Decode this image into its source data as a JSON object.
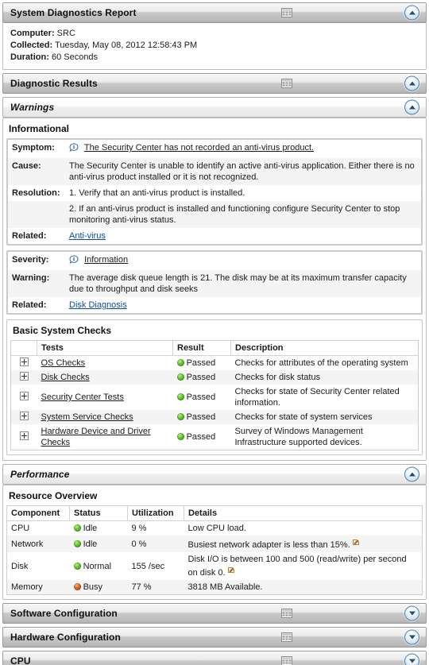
{
  "report": {
    "title": "System Diagnostics Report",
    "info": [
      {
        "label": "Computer:",
        "value": "SRC"
      },
      {
        "label": "Collected:",
        "value": "Tuesday, May 08, 2012 12:58:43 PM"
      },
      {
        "label": "Duration:",
        "value": "60 Seconds"
      }
    ]
  },
  "diagnostic_results": {
    "title": "Diagnostic Results",
    "warnings": {
      "title": "Warnings",
      "informational": {
        "title": "Informational",
        "item1": {
          "symptom_label": "Symptom:",
          "symptom_text": "The Security Center has not recorded an anti-virus product.",
          "symptom_icon": "information-icon",
          "cause_label": "Cause:",
          "cause_text": "The Security Center is unable to identify an active anti-virus application. Either there is no anti-virus product installed or it is not recognized.",
          "resolution_label": "Resolution:",
          "resolution_1": "1. Verify that an anti-virus product is installed.",
          "resolution_2": "2. If an anti-virus product is installed and functioning configure Security Center to stop monitoring anti-virus status.",
          "related_label": "Related:",
          "related_text": "Anti-virus"
        },
        "item2": {
          "severity_label": "Severity:",
          "severity_text": "Information",
          "severity_icon": "information-icon",
          "warning_label": "Warning:",
          "warning_text": "The average disk queue length is 21. The disk may be at its maximum transfer capacity due to throughput and disk seeks",
          "related_label": "Related:",
          "related_text": "Disk Diagnosis"
        }
      }
    },
    "basic_system_checks": {
      "title": "Basic System Checks",
      "columns": [
        "Tests",
        "Result",
        "Description"
      ],
      "rows": [
        {
          "test": "OS Checks",
          "status": "green",
          "result": "Passed",
          "description": "Checks for attributes of the operating system"
        },
        {
          "test": "Disk Checks",
          "status": "green",
          "result": "Passed",
          "description": "Checks for disk status"
        },
        {
          "test": "Security Center Tests",
          "status": "green",
          "result": "Passed",
          "description": "Checks for state of Security Center related information."
        },
        {
          "test": "System Service Checks",
          "status": "green",
          "result": "Passed",
          "description": "Checks for state of system services"
        },
        {
          "test": "Hardware Device and Driver Checks",
          "status": "green",
          "result": "Passed",
          "description": "Survey of Windows Management Infrastructure supported devices."
        }
      ]
    }
  },
  "performance": {
    "title": "Performance",
    "resource_overview": {
      "title": "Resource Overview",
      "columns": [
        "Component",
        "Status",
        "Utilization",
        "Details"
      ],
      "rows": [
        {
          "component": "CPU",
          "status": "green",
          "status_text": "Idle",
          "utilization": "9 %",
          "details": "Low CPU load.",
          "note": false
        },
        {
          "component": "Network",
          "status": "green",
          "status_text": "Idle",
          "utilization": "0 %",
          "details": "Busiest network adapter is less than 15%.",
          "note": true
        },
        {
          "component": "Disk",
          "status": "green",
          "status_text": "Normal",
          "utilization": "155 /sec",
          "details": "Disk I/O is between 100 and 500 (read/write) per second on disk 0.",
          "note": true
        },
        {
          "component": "Memory",
          "status": "red",
          "status_text": "Busy",
          "utilization": "77 %",
          "details": "3818 MB Available.",
          "note": false
        }
      ]
    }
  },
  "collapsed_sections": [
    {
      "title": "Software Configuration"
    },
    {
      "title": "Hardware Configuration"
    },
    {
      "title": "CPU"
    }
  ]
}
